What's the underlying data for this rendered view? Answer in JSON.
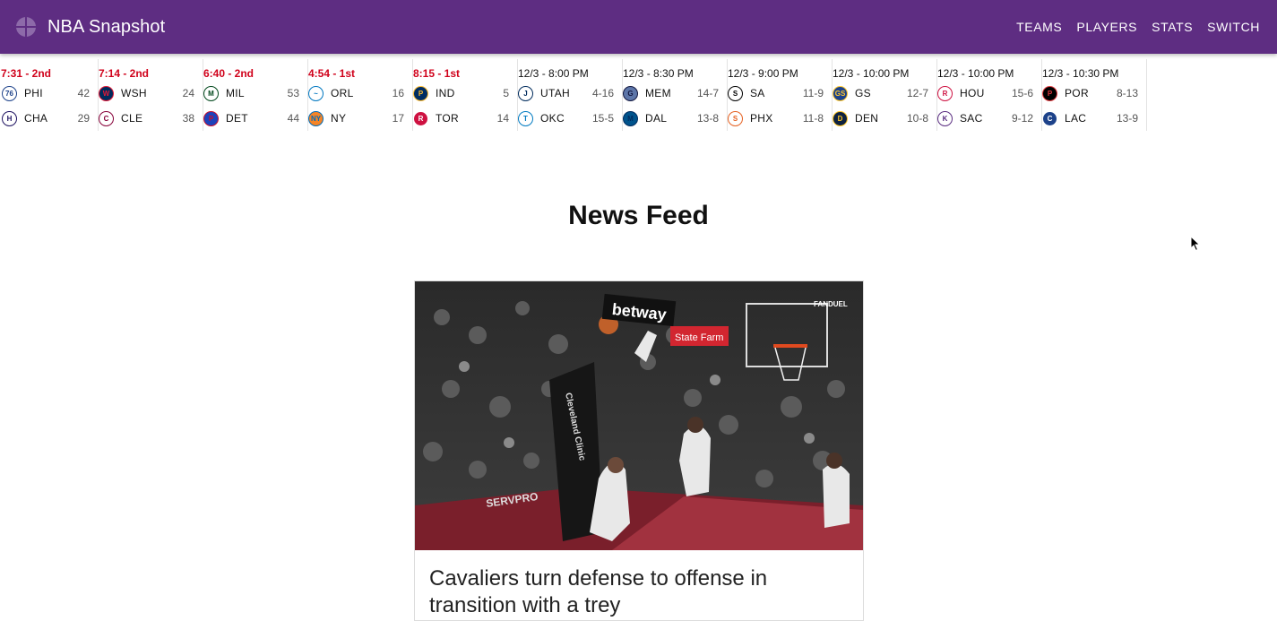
{
  "app": {
    "title": "NBA Snapshot",
    "nav": [
      "TEAMS",
      "PLAYERS",
      "STATS",
      "SWITCH"
    ]
  },
  "colors": {
    "appbar": "#5e2d82",
    "live_status": "#d0021b"
  },
  "scoreboard": [
    {
      "status": "7:31 - 2nd",
      "live": true,
      "teams": [
        {
          "abbr": "PHI",
          "value": "42",
          "logo": "76ers-logo"
        },
        {
          "abbr": "CHA",
          "value": "29",
          "logo": "hornets-logo"
        }
      ]
    },
    {
      "status": "7:14 - 2nd",
      "live": true,
      "teams": [
        {
          "abbr": "WSH",
          "value": "24",
          "logo": "wizards-logo"
        },
        {
          "abbr": "CLE",
          "value": "38",
          "logo": "cavaliers-logo"
        }
      ]
    },
    {
      "status": "6:40 - 2nd",
      "live": true,
      "teams": [
        {
          "abbr": "MIL",
          "value": "53",
          "logo": "bucks-logo"
        },
        {
          "abbr": "DET",
          "value": "44",
          "logo": "pistons-logo"
        }
      ]
    },
    {
      "status": "4:54 - 1st",
      "live": true,
      "teams": [
        {
          "abbr": "ORL",
          "value": "16",
          "logo": "magic-logo"
        },
        {
          "abbr": "NY",
          "value": "17",
          "logo": "knicks-logo"
        }
      ]
    },
    {
      "status": "8:15 - 1st",
      "live": true,
      "teams": [
        {
          "abbr": "IND",
          "value": "5",
          "logo": "pacers-logo"
        },
        {
          "abbr": "TOR",
          "value": "14",
          "logo": "raptors-logo"
        }
      ]
    },
    {
      "status": "12/3 - 8:00 PM",
      "live": false,
      "teams": [
        {
          "abbr": "UTAH",
          "value": "4-16",
          "logo": "jazz-logo"
        },
        {
          "abbr": "OKC",
          "value": "15-5",
          "logo": "thunder-logo"
        }
      ]
    },
    {
      "status": "12/3 - 8:30 PM",
      "live": false,
      "teams": [
        {
          "abbr": "MEM",
          "value": "14-7",
          "logo": "grizzlies-logo"
        },
        {
          "abbr": "DAL",
          "value": "13-8",
          "logo": "mavericks-logo"
        }
      ]
    },
    {
      "status": "12/3 - 9:00 PM",
      "live": false,
      "teams": [
        {
          "abbr": "SA",
          "value": "11-9",
          "logo": "spurs-logo"
        },
        {
          "abbr": "PHX",
          "value": "11-8",
          "logo": "suns-logo"
        }
      ]
    },
    {
      "status": "12/3 - 10:00 PM",
      "live": false,
      "teams": [
        {
          "abbr": "GS",
          "value": "12-7",
          "logo": "warriors-logo"
        },
        {
          "abbr": "DEN",
          "value": "10-8",
          "logo": "nuggets-logo"
        }
      ]
    },
    {
      "status": "12/3 - 10:00 PM",
      "live": false,
      "teams": [
        {
          "abbr": "HOU",
          "value": "15-6",
          "logo": "rockets-logo"
        },
        {
          "abbr": "SAC",
          "value": "9-12",
          "logo": "kings-logo"
        }
      ]
    },
    {
      "status": "12/3 - 10:30 PM",
      "live": false,
      "teams": [
        {
          "abbr": "POR",
          "value": "8-13",
          "logo": "blazers-logo"
        },
        {
          "abbr": "LAC",
          "value": "13-9",
          "logo": "clippers-logo"
        }
      ]
    }
  ],
  "news": {
    "title": "News Feed",
    "cards": [
      {
        "headline": "Cavaliers turn defense to offense in transition with a trey",
        "image_signage": [
          "betway",
          "State Farm",
          "FANDUEL",
          "Cleveland Clinic",
          "SERVPRO"
        ]
      }
    ]
  }
}
